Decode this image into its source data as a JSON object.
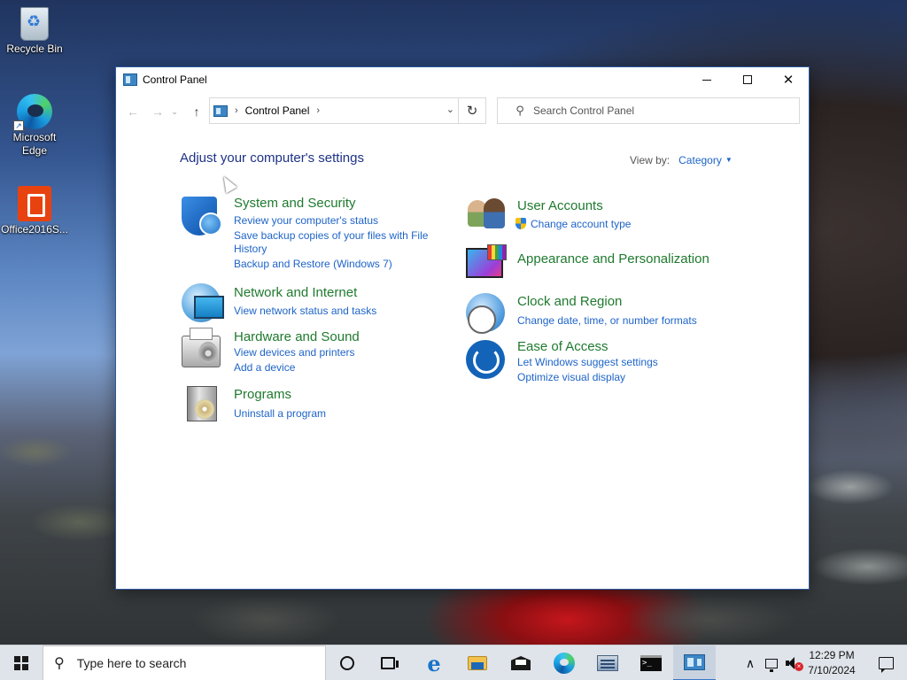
{
  "desktop": {
    "icons": [
      {
        "label": "Recycle Bin"
      },
      {
        "label": "Microsoft Edge"
      },
      {
        "label": "Office2016S..."
      }
    ]
  },
  "window": {
    "title": "Control Panel",
    "address": {
      "crumb": "Control Panel"
    },
    "search": {
      "placeholder": "Search Control Panel"
    },
    "heading": "Adjust your computer's settings",
    "view_by": {
      "label": "View by:",
      "value": "Category"
    },
    "categories": [
      {
        "title": "System and Security",
        "icon": "shield-icon",
        "links": [
          "Review your computer's status",
          "Save backup copies of your files with File",
          "History",
          "Backup and Restore (Windows 7)"
        ]
      },
      {
        "title": "Network and Internet",
        "icon": "network-icon",
        "links": [
          "View network status and tasks"
        ]
      },
      {
        "title": "Hardware and Sound",
        "icon": "printer-icon",
        "links": [
          "View devices and printers",
          "Add a device"
        ]
      },
      {
        "title": "Programs",
        "icon": "programs-icon",
        "links": [
          "Uninstall a program"
        ]
      },
      {
        "title": "User Accounts",
        "icon": "users-icon",
        "links": [
          "Change account type"
        ]
      },
      {
        "title": "Appearance and Personalization",
        "icon": "appearance-icon",
        "links": []
      },
      {
        "title": "Clock and Region",
        "icon": "clock-icon",
        "links": [
          "Change date, time, or number formats"
        ]
      },
      {
        "title": "Ease of Access",
        "icon": "ease-of-access-icon",
        "links": [
          "Let Windows suggest settings",
          "Optimize visual display"
        ]
      }
    ]
  },
  "taskbar": {
    "search_placeholder": "Type here to search",
    "clock": {
      "time": "12:29 PM",
      "date": "7/10/2024"
    },
    "cmd_prompt_glyph": ">_"
  }
}
